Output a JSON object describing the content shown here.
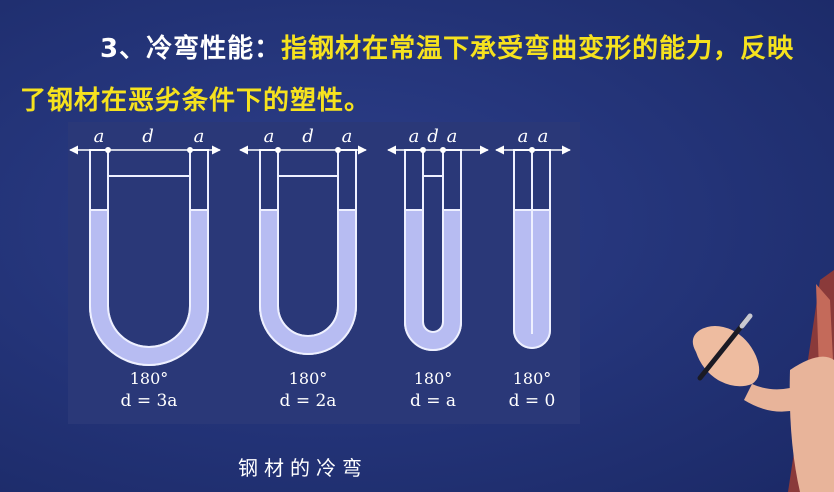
{
  "heading": {
    "number": "3、",
    "term": "冷弯性能",
    "colon": "：",
    "definition_part1": "指钢材在常温下承受弯曲变形的能力，反映",
    "definition_part2": "了钢材在恶劣条件下的塑性。"
  },
  "colors": {
    "background": "#233377",
    "term_text": "#ffffff",
    "definition_text": "#f6e21e",
    "specimen_fill": "#b7bcf2",
    "specimen_outline": "#eef0ff"
  },
  "specimens": [
    {
      "label_a_left": "a",
      "label_d": "d",
      "label_a_right": "a",
      "angle": "180°",
      "formula": "d = 3a",
      "d_over_a": 3
    },
    {
      "label_a_left": "a",
      "label_d": "d",
      "label_a_right": "a",
      "angle": "180°",
      "formula": "d = 2a",
      "d_over_a": 2
    },
    {
      "label_a_left": "a",
      "label_d": "d",
      "label_a_right": "a",
      "angle": "180°",
      "formula": "d = a",
      "d_over_a": 1
    },
    {
      "label_a_left": "a",
      "label_d": "",
      "label_a_right": "a",
      "angle": "180°",
      "formula": "d = 0",
      "d_over_a": 0
    }
  ],
  "caption": "钢材的冷弯"
}
